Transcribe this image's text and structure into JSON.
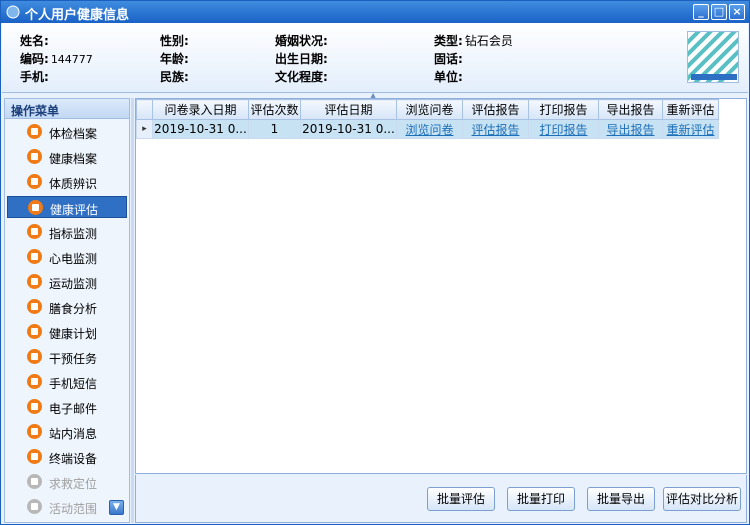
{
  "window": {
    "title": "个人用户健康信息",
    "controls": {
      "minimize": "_",
      "maximize": "□",
      "close": "×"
    }
  },
  "info": {
    "name_label": "姓名:",
    "name_value": "",
    "gender_label": "性别:",
    "gender_value": "",
    "marital_label": "婚姻状况:",
    "marital_value": "",
    "type_label": "类型:",
    "type_value": "钻石会员",
    "code_label": "编码:",
    "code_value": "144777",
    "age_label": "年龄:",
    "age_value": "",
    "birth_label": "出生日期:",
    "birth_value": "",
    "landline_label": "固话:",
    "landline_value": "",
    "mobile_label": "手机:",
    "mobile_value": "",
    "ethnicity_label": "民族:",
    "ethnicity_value": "",
    "education_label": "文化程度:",
    "education_value": "",
    "employer_label": "单位:",
    "employer_value": ""
  },
  "sidebar": {
    "header": "操作菜单",
    "items": [
      {
        "label": "体检档案",
        "icon": "file-icon",
        "state": "normal"
      },
      {
        "label": "健康档案",
        "icon": "list-icon",
        "state": "normal"
      },
      {
        "label": "体质辨识",
        "icon": "ring-icon",
        "state": "normal"
      },
      {
        "label": "健康评估",
        "icon": "chart-icon",
        "state": "active"
      },
      {
        "label": "指标监测",
        "icon": "drop-icon",
        "state": "normal"
      },
      {
        "label": "心电监测",
        "icon": "heart-icon",
        "state": "normal"
      },
      {
        "label": "运动监测",
        "icon": "bars-icon",
        "state": "normal"
      },
      {
        "label": "膳食分析",
        "icon": "bowl-icon",
        "state": "normal"
      },
      {
        "label": "健康计划",
        "icon": "plan-icon",
        "state": "normal"
      },
      {
        "label": "干预任务",
        "icon": "task-icon",
        "state": "normal"
      },
      {
        "label": "手机短信",
        "icon": "phone-icon",
        "state": "normal"
      },
      {
        "label": "电子邮件",
        "icon": "mail-icon",
        "state": "normal"
      },
      {
        "label": "站内消息",
        "icon": "message-icon",
        "state": "normal"
      },
      {
        "label": "终端设备",
        "icon": "device-icon",
        "state": "normal"
      },
      {
        "label": "求救定位",
        "icon": "location-icon",
        "state": "disabled"
      },
      {
        "label": "活动范围",
        "icon": "range-icon",
        "state": "disabled"
      }
    ]
  },
  "grid": {
    "columns": [
      "问卷录入日期",
      "评估次数",
      "评估日期",
      "浏览问卷",
      "评估报告",
      "打印报告",
      "导出报告",
      "重新评估"
    ],
    "rows": [
      [
        "2019-10-31 0...",
        "1",
        "2019-10-31 0...",
        "浏览问卷",
        "评估报告",
        "打印报告",
        "导出报告",
        "重新评估"
      ]
    ],
    "row_indicator": "▸"
  },
  "buttons": {
    "batch_assess": "批量评估",
    "batch_print": "批量打印",
    "batch_export": "批量导出",
    "compare": "评估对比分析"
  },
  "colors": {
    "accent": "#1a62c6",
    "menu_icon": "#f07a16",
    "active_menu": "#2f6fc4",
    "link": "#1d6fb8"
  }
}
